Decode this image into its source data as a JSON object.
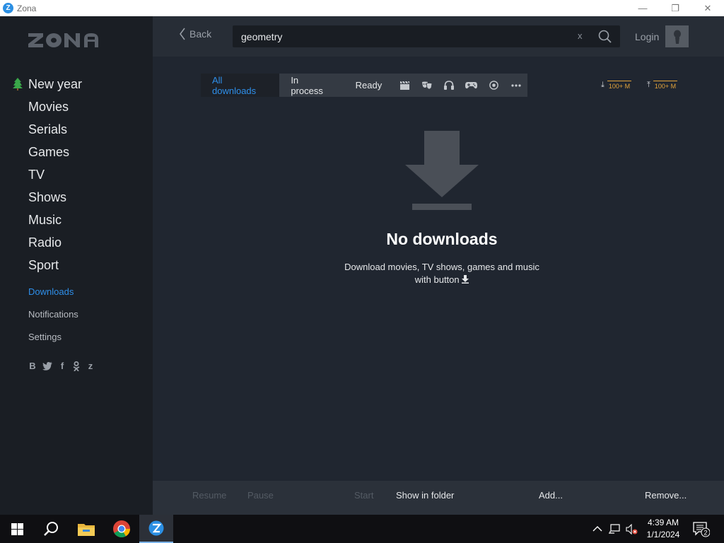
{
  "window": {
    "title": "Zona",
    "app_icon_letter": "Z"
  },
  "sidebar": {
    "logo": "ZONA",
    "main_items": [
      {
        "label": "New year",
        "icon": "tree-icon"
      },
      {
        "label": "Movies"
      },
      {
        "label": "Serials"
      },
      {
        "label": "Games"
      },
      {
        "label": "TV"
      },
      {
        "label": "Shows"
      },
      {
        "label": "Music"
      },
      {
        "label": "Radio"
      },
      {
        "label": "Sport"
      }
    ],
    "sub_items": [
      {
        "label": "Downloads",
        "active": true
      },
      {
        "label": "Notifications"
      },
      {
        "label": "Settings"
      }
    ],
    "socials": [
      "B",
      "t",
      "f",
      "ok",
      "z"
    ]
  },
  "header": {
    "back_label": "Back",
    "search_value": "geometry",
    "clear_label": "x",
    "login_label": "Login"
  },
  "filters": {
    "tabs": [
      "All downloads",
      "In process",
      "Ready"
    ],
    "active_tab": "All downloads",
    "icons": [
      "clapper-icon",
      "theater-masks-icon",
      "headphones-icon",
      "gamepad-icon",
      "soccer-ball-icon",
      "more-icon"
    ]
  },
  "speed": {
    "download": "100+ M",
    "upload": "100+ M"
  },
  "empty_state": {
    "title": "No downloads",
    "line1": "Download movies, TV shows, games and music",
    "line2": "with button"
  },
  "actions": {
    "resume": "Resume",
    "pause": "Pause",
    "start": "Start",
    "show_in_folder": "Show in folder",
    "add": "Add...",
    "remove": "Remove..."
  },
  "taskbar": {
    "time": "4:39 AM",
    "date": "1/1/2024",
    "notification_count": "2"
  },
  "colors": {
    "accent": "#2e8fea",
    "speed": "#e0a23a",
    "sidebar_bg": "#1a1e24",
    "main_bg": "#202630"
  }
}
